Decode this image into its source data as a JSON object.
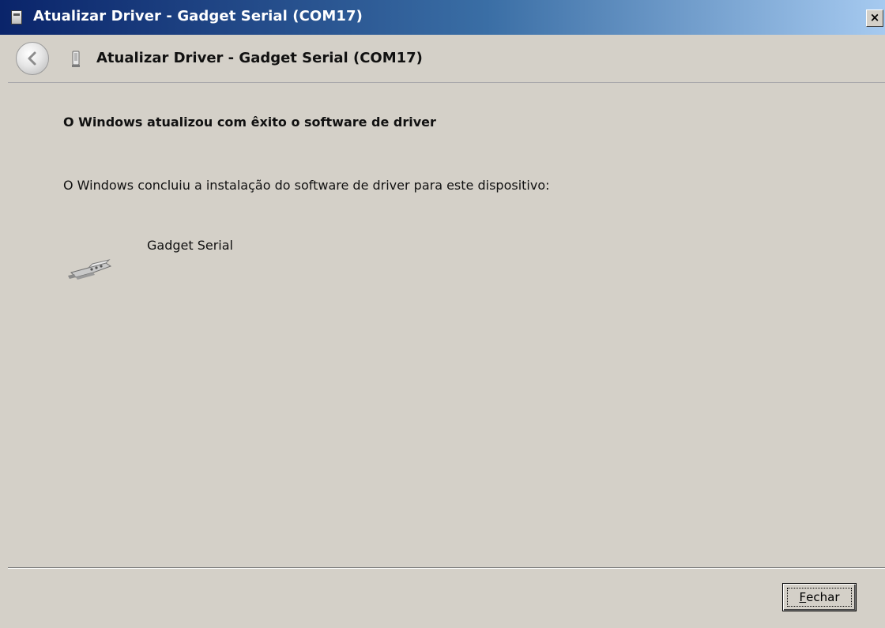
{
  "window": {
    "title": "Atualizar Driver - Gadget Serial (COM17)",
    "close_glyph": "×"
  },
  "header": {
    "title": "Atualizar Driver - Gadget Serial (COM17)",
    "back_icon": "back-arrow-icon"
  },
  "content": {
    "heading": "O Windows atualizou com êxito o software de driver",
    "message": "O Windows concluiu a instalação do software de driver para este dispositivo:",
    "device": {
      "name": "Gadget Serial",
      "icon": "serial-connector-icon"
    }
  },
  "footer": {
    "close_button": {
      "mnemonic": "F",
      "rest": "echar"
    }
  },
  "colors": {
    "titlebar_start": "#0a246a",
    "titlebar_end": "#a6caf0",
    "dialog_bg": "#d4d0c8"
  }
}
